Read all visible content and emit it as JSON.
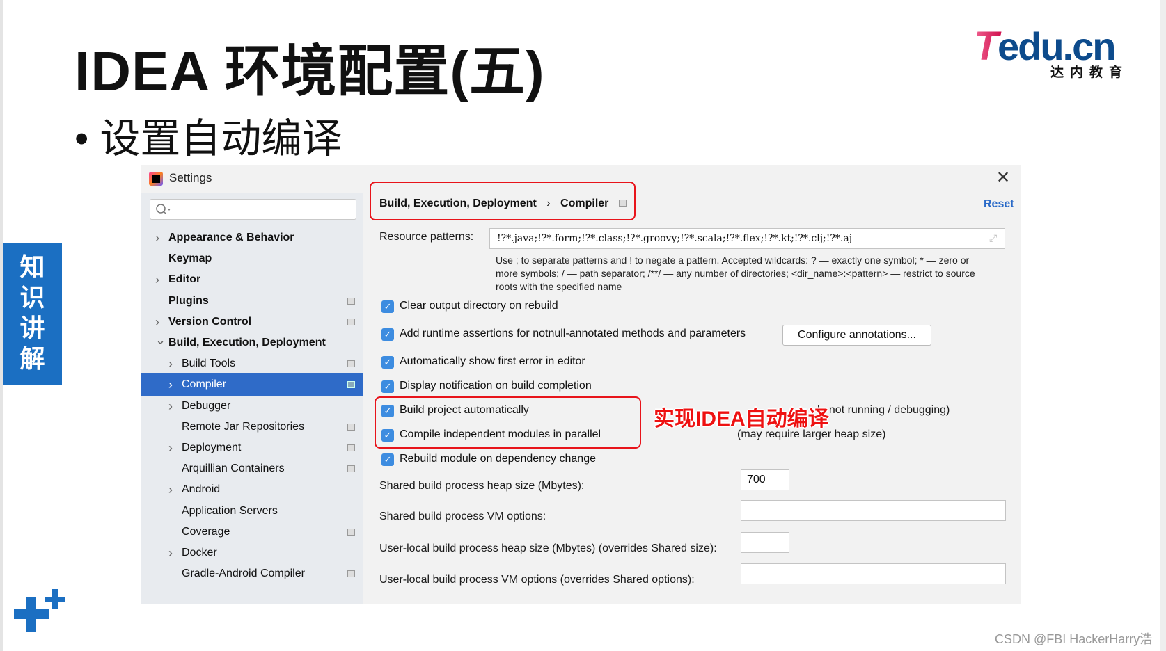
{
  "slide": {
    "title": "IDEA 环境配置(五)",
    "bullet": "设置自动编译",
    "badge": "知识讲解",
    "logo_text": "Tedu.cn",
    "logo_sub": "达内教育",
    "watermark": "CSDN @FBI HackerHarry浩",
    "annotation": "实现IDEA自动编译",
    "colors": {
      "badge": "#1b6fc2",
      "annotation": "#ee1111",
      "logo_blue": "#0d4b8c",
      "logo_pink": "#e0185a"
    }
  },
  "dialog": {
    "title": "Settings",
    "close_icon": "close-icon",
    "reset": "Reset",
    "breadcrumb": [
      "Build, Execution, Deployment",
      "Compiler"
    ],
    "sidebar": [
      {
        "label": "Appearance & Behavior",
        "level": 0,
        "chevron": true,
        "bold": true,
        "pin": false
      },
      {
        "label": "Keymap",
        "level": 0,
        "chevron": false,
        "bold": true,
        "pin": false
      },
      {
        "label": "Editor",
        "level": 0,
        "chevron": true,
        "bold": true,
        "pin": false
      },
      {
        "label": "Plugins",
        "level": 0,
        "chevron": false,
        "bold": true,
        "pin": true
      },
      {
        "label": "Version Control",
        "level": 0,
        "chevron": true,
        "bold": true,
        "pin": true
      },
      {
        "label": "Build, Execution, Deployment",
        "level": 0,
        "chevron": "open",
        "bold": true,
        "pin": false
      },
      {
        "label": "Build Tools",
        "level": 1,
        "chevron": true,
        "pin": true
      },
      {
        "label": "Compiler",
        "level": 1,
        "chevron": true,
        "pin": true,
        "selected": true
      },
      {
        "label": "Debugger",
        "level": 1,
        "chevron": true,
        "pin": false
      },
      {
        "label": "Remote Jar Repositories",
        "level": 1,
        "chevron": false,
        "pin": true
      },
      {
        "label": "Deployment",
        "level": 1,
        "chevron": true,
        "pin": true
      },
      {
        "label": "Arquillian Containers",
        "level": 1,
        "chevron": false,
        "pin": true
      },
      {
        "label": "Android",
        "level": 1,
        "chevron": true,
        "pin": false
      },
      {
        "label": "Application Servers",
        "level": 1,
        "chevron": false,
        "pin": false
      },
      {
        "label": "Coverage",
        "level": 1,
        "chevron": false,
        "pin": true
      },
      {
        "label": "Docker",
        "level": 1,
        "chevron": true,
        "pin": false
      },
      {
        "label": "Gradle-Android Compiler",
        "level": 1,
        "chevron": false,
        "pin": true
      }
    ],
    "resource_label": "Resource patterns:",
    "resource_value": "!?*.java;!?*.form;!?*.class;!?*.groovy;!?*.scala;!?*.flex;!?*.kt;!?*.clj;!?*.aj",
    "help_lines": [
      "Use ; to separate patterns and ! to negate a pattern. Accepted wildcards: ? — exactly one symbol; * — zero or",
      "more symbols; / — path separator; /**/ — any number of directories; <dir_name>:<pattern> — restrict to source",
      "roots with the specified name"
    ],
    "checkboxes": [
      {
        "label": "Clear output directory on rebuild",
        "checked": true
      },
      {
        "label": "Add runtime assertions for notnull-annotated methods and parameters",
        "checked": true
      },
      {
        "label": "Automatically show first error in editor",
        "checked": true
      },
      {
        "label": "Display notification on build completion",
        "checked": true
      },
      {
        "label": "Build project automatically",
        "checked": true
      },
      {
        "label": "Compile independent modules in parallel",
        "checked": true
      },
      {
        "label": "Rebuild module on dependency change",
        "checked": true
      }
    ],
    "configure_button": "Configure annotations...",
    "build_note": "le not running / debugging)",
    "parallel_note": "(may require larger heap size)",
    "fields": [
      {
        "label": "Shared build process heap size (Mbytes):",
        "value": "700"
      },
      {
        "label": "Shared build process VM options:",
        "value": ""
      },
      {
        "label": "User-local build process heap size (Mbytes) (overrides Shared size):",
        "value": ""
      },
      {
        "label": "User-local build process VM options (overrides Shared options):",
        "value": ""
      }
    ]
  }
}
